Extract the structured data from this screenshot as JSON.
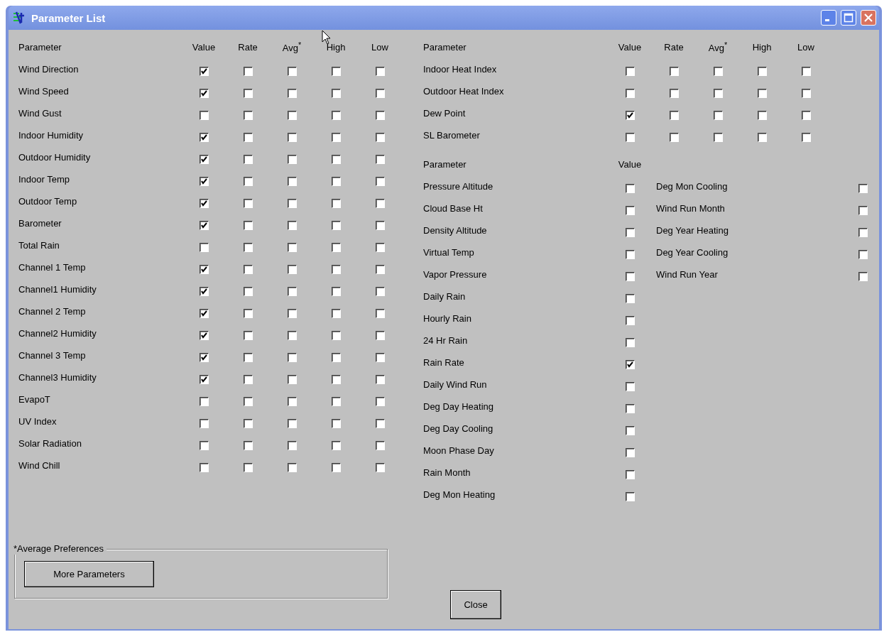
{
  "window": {
    "title": "Parameter List"
  },
  "table_left": {
    "columns": [
      "Parameter",
      "Value",
      "Rate",
      "Avg$^{*}$",
      "High",
      "Low"
    ],
    "rows": [
      {
        "name": "Wind Direction",
        "checks": [
          true,
          false,
          false,
          false,
          false
        ]
      },
      {
        "name": "Wind Speed",
        "checks": [
          true,
          false,
          false,
          false,
          false
        ]
      },
      {
        "name": "Wind Gust",
        "checks": [
          false,
          false,
          false,
          false,
          false
        ]
      },
      {
        "name": "Indoor Humidity",
        "checks": [
          true,
          false,
          false,
          false,
          false
        ]
      },
      {
        "name": "Outdoor Humidity",
        "checks": [
          true,
          false,
          false,
          false,
          false
        ]
      },
      {
        "name": "Indoor Temp",
        "checks": [
          true,
          false,
          false,
          false,
          false
        ]
      },
      {
        "name": "Outdoor Temp",
        "checks": [
          true,
          false,
          false,
          false,
          false
        ]
      },
      {
        "name": "Barometer",
        "checks": [
          true,
          false,
          false,
          false,
          false
        ]
      },
      {
        "name": "Total Rain",
        "checks": [
          false,
          false,
          false,
          false,
          false
        ]
      },
      {
        "name": "Channel 1 Temp",
        "checks": [
          true,
          false,
          false,
          false,
          false
        ]
      },
      {
        "name": "Channel1 Humidity",
        "checks": [
          true,
          false,
          false,
          false,
          false
        ]
      },
      {
        "name": "Channel 2 Temp",
        "checks": [
          true,
          false,
          false,
          false,
          false
        ]
      },
      {
        "name": "Channel2 Humidity",
        "checks": [
          true,
          false,
          false,
          false,
          false
        ]
      },
      {
        "name": "Channel 3 Temp",
        "checks": [
          true,
          false,
          false,
          false,
          false
        ]
      },
      {
        "name": "Channel3 Humidity",
        "checks": [
          true,
          false,
          false,
          false,
          false
        ]
      },
      {
        "name": "EvapoT",
        "checks": [
          false,
          false,
          false,
          false,
          false
        ]
      },
      {
        "name": "UV Index",
        "checks": [
          false,
          false,
          false,
          false,
          false
        ]
      },
      {
        "name": "Solar Radiation",
        "checks": [
          false,
          false,
          false,
          false,
          false
        ]
      },
      {
        "name": "Wind Chill",
        "checks": [
          false,
          false,
          false,
          false,
          false
        ]
      }
    ]
  },
  "table_right": {
    "columns": [
      "Parameter",
      "Value",
      "Rate",
      "Avg$^{*}$",
      "High",
      "Low"
    ],
    "rows": [
      {
        "name": "Indoor Heat Index",
        "checks": [
          false,
          false,
          false,
          false,
          false
        ]
      },
      {
        "name": "Outdoor Heat Index",
        "checks": [
          false,
          false,
          false,
          false,
          false
        ]
      },
      {
        "name": "Dew Point",
        "checks": [
          true,
          false,
          false,
          false,
          false
        ]
      },
      {
        "name": "SL Barometer",
        "checks": [
          false,
          false,
          false,
          false,
          false
        ]
      }
    ]
  },
  "table_value_only": {
    "columns": [
      "Parameter",
      "Value"
    ],
    "rows": [
      {
        "name": "Pressure Altitude",
        "checked": false
      },
      {
        "name": "Cloud Base Ht",
        "checked": false
      },
      {
        "name": "Density Altitude",
        "checked": false
      },
      {
        "name": "Virtual Temp",
        "checked": false
      },
      {
        "name": "Vapor Pressure",
        "checked": false
      },
      {
        "name": "Daily Rain",
        "checked": false
      },
      {
        "name": "Hourly Rain",
        "checked": false
      },
      {
        "name": "24 Hr Rain",
        "checked": false
      },
      {
        "name": "Rain Rate",
        "checked": true
      },
      {
        "name": "Daily Wind Run",
        "checked": false
      },
      {
        "name": "Deg Day Heating",
        "checked": false
      },
      {
        "name": "Deg Day Cooling",
        "checked": false
      },
      {
        "name": "Moon Phase Day",
        "checked": false
      },
      {
        "name": "Rain Month",
        "checked": false
      },
      {
        "name": "Deg Mon Heating",
        "checked": false
      }
    ],
    "rows_column_2": [
      {
        "name": "Deg Mon Cooling",
        "checked": false
      },
      {
        "name": "Wind Run Month",
        "checked": false
      },
      {
        "name": "Deg Year Heating",
        "checked": false
      },
      {
        "name": "Deg Year Cooling",
        "checked": false
      },
      {
        "name": "Wind Run Year",
        "checked": false
      }
    ]
  },
  "average_preferences": {
    "label": "*Average Preferences",
    "button": "More Parameters"
  },
  "close_button": "Close"
}
